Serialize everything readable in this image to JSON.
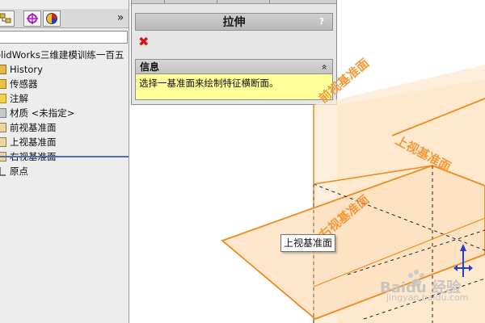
{
  "tree": {
    "root_label": "olidWorks三维建模训练一百五",
    "items": [
      {
        "label": "History"
      },
      {
        "label": "传感器"
      },
      {
        "label": "注解"
      },
      {
        "label": "材质 <未指定>"
      },
      {
        "label": "前视基准面"
      },
      {
        "label": "上视基准面"
      },
      {
        "label": "右视基准面"
      },
      {
        "label": "原点"
      }
    ],
    "expand_symbol": "»"
  },
  "property_manager": {
    "title": "拉伸",
    "help_symbol": "?",
    "cancel_symbol": "✖",
    "message": {
      "header": "信息",
      "collapse_symbol": "«",
      "text": "选择一基准面来绘制特征横断面。"
    }
  },
  "viewport": {
    "plane_labels": {
      "front": "前视基准面",
      "top": "上视基准面",
      "right": "右视基准面"
    },
    "tooltip": "上视基准面",
    "watermark": "Baidu 经验",
    "watermark_sub": "jingyan.baidu.com"
  },
  "colors": {
    "plane_edge": "#f08a1c",
    "plane_fill": "#fde4c6",
    "plane_label": "#f39a3a",
    "message_bg": "#ffff99",
    "cancel": "#d11414",
    "axis": "#1f3fd6"
  }
}
